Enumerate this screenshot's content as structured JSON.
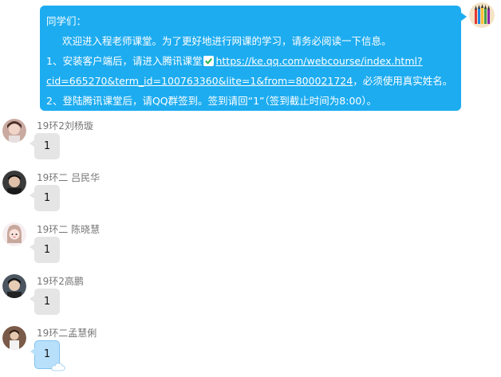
{
  "teacher": {
    "avatar_icon": "colored-pencils-avatar",
    "greeting": "同学们：",
    "intro": "欢迎进入程老师课堂。为了更好地进行网课的学习，请务必阅读一下信息。",
    "step1_prefix": "1、安装客户端后，请进入腾讯课堂",
    "step1_link_part1": "https://ke.qq.com/webcourse/index.html?",
    "step1_link_part2": "cid=665270&term_id=100763360&lite=1&from=800021724",
    "step1_suffix": "，必须使用真实姓名。",
    "step2": "2、登陆腾讯课堂后，请QQ群签到。签到请回“1”（签到截止时间为8:00）。",
    "bubble_color": "#1dacf0"
  },
  "students": [
    {
      "name": "19环2刘杨璇",
      "reply": "1"
    },
    {
      "name": "19环二   吕民华",
      "reply": "1"
    },
    {
      "name": "19环二 陈晓慧",
      "reply": "1"
    },
    {
      "name": "19环2高鹏",
      "reply": "1"
    },
    {
      "name": "19环二孟慧俐",
      "reply": "1"
    }
  ]
}
